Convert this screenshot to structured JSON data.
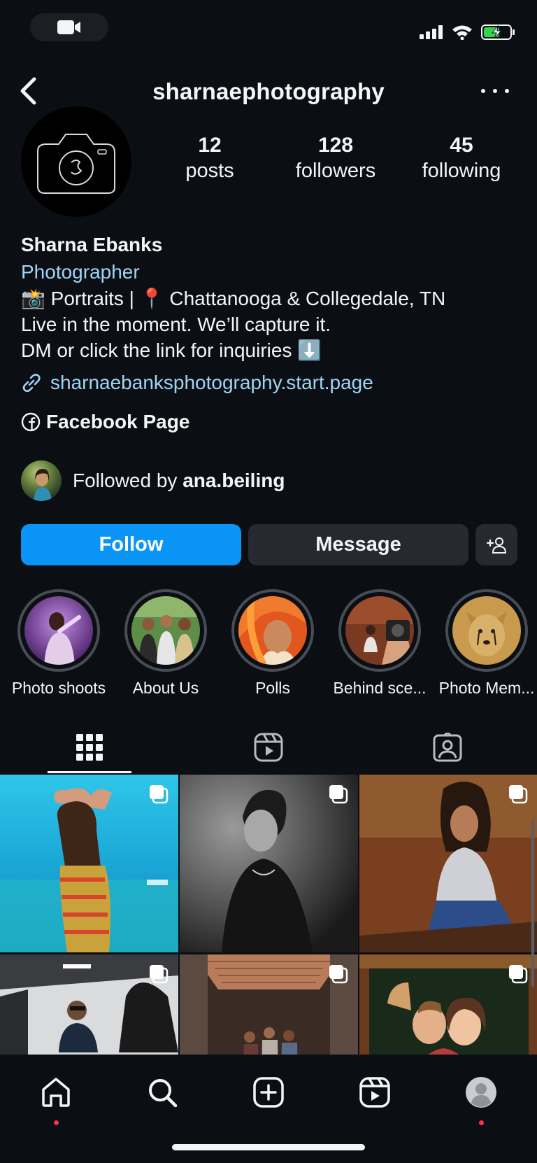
{
  "header": {
    "username": "sharnaephotography"
  },
  "stats": [
    {
      "num": "12",
      "label": "posts"
    },
    {
      "num": "128",
      "label": "followers"
    },
    {
      "num": "45",
      "label": "following"
    }
  ],
  "bio": {
    "name": "Sharna Ebanks",
    "category": "Photographer",
    "lines": [
      "📸 Portraits | 📍 Chattanooga & Collegedale, TN",
      "Live in the moment. We’ll capture it.",
      "DM or click the link for inquiries ⬇️"
    ],
    "link": "sharnaebanksphotography.start.page",
    "facebook": "Facebook Page"
  },
  "followed_by": {
    "prefix": "Followed by ",
    "user": "ana.beiling"
  },
  "buttons": {
    "follow": "Follow",
    "message": "Message"
  },
  "highlights": [
    {
      "label": "Photo shoots"
    },
    {
      "label": "About Us"
    },
    {
      "label": "Polls"
    },
    {
      "label": "Behind sce..."
    },
    {
      "label": "Photo Mem..."
    }
  ],
  "colors": {
    "accent": "#0a95f6",
    "link": "#9fd4f6",
    "background": "#0b0f14",
    "notification": "#ff3040"
  },
  "icons": {
    "status": [
      "video-icon",
      "signal-icon",
      "wifi-icon",
      "battery-charging-icon"
    ],
    "tabs": [
      "grid-icon",
      "reels-icon",
      "tagged-icon"
    ],
    "nav": [
      "home-icon",
      "search-icon",
      "create-icon",
      "reels-icon",
      "profile-avatar-icon"
    ]
  }
}
